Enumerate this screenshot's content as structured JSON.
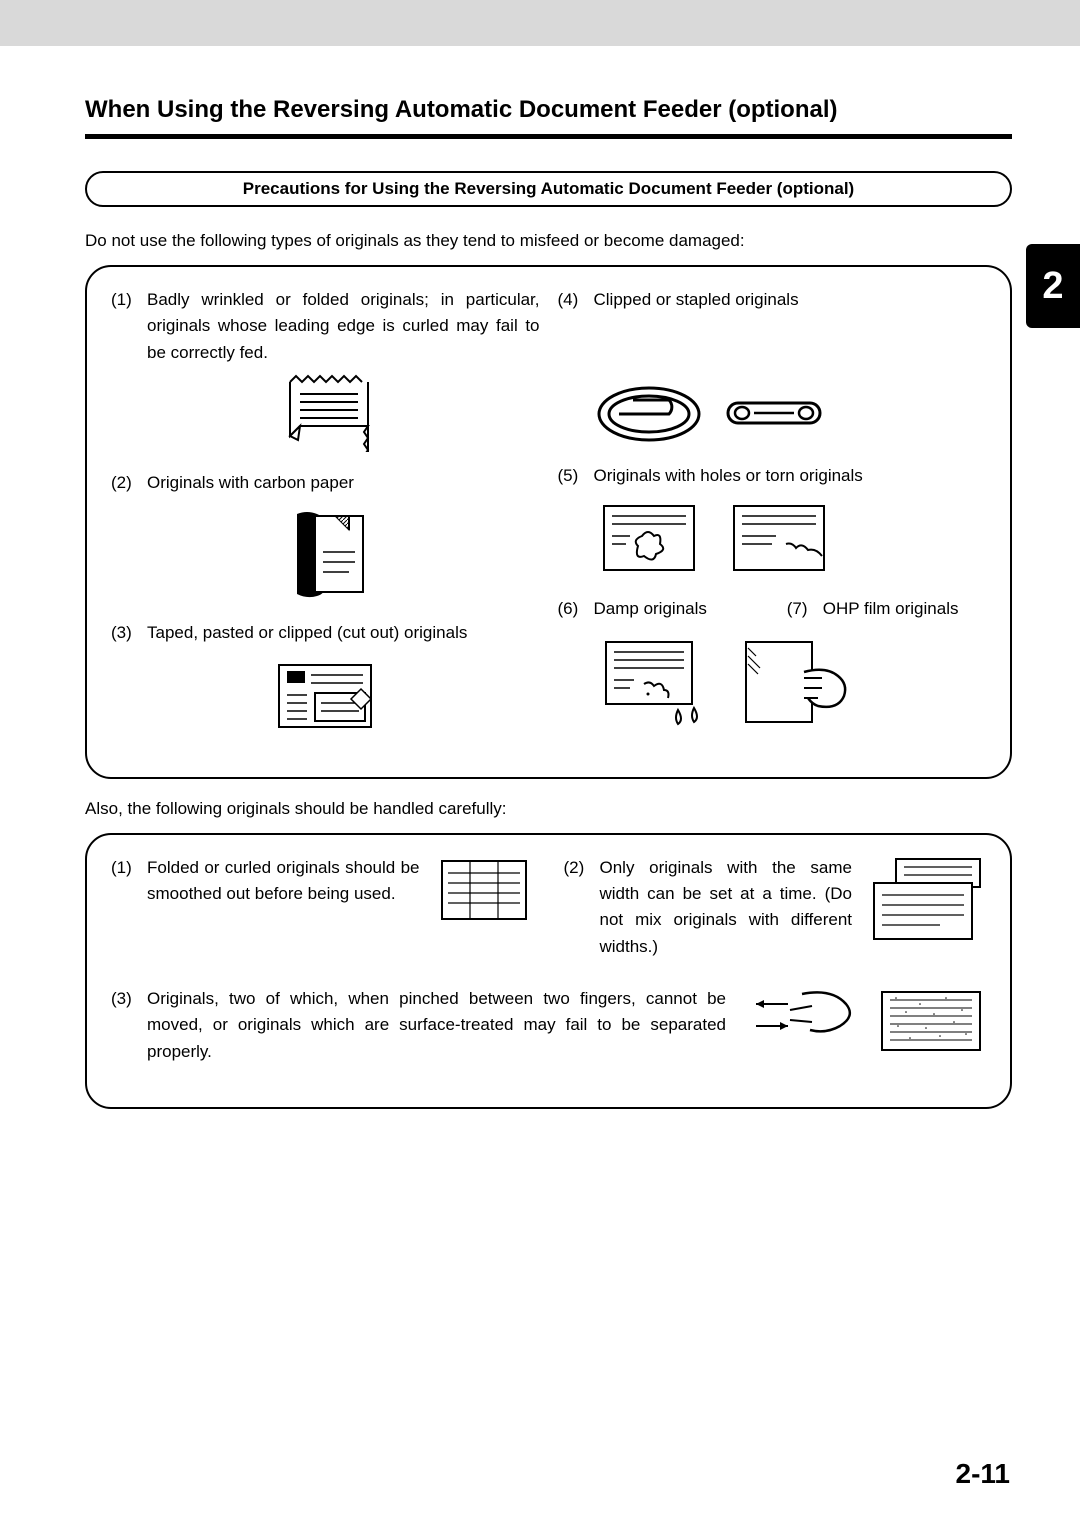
{
  "header": {
    "title": "When Using the Reversing Automatic Document Feeder (optional)"
  },
  "pill": "Precautions for Using the Reversing Automatic Document Feeder (optional)",
  "intro1": "Do not use the following types of originals as they tend to misfeed or become damaged:",
  "box1": {
    "left": [
      {
        "num": "(1)",
        "text": "Badly wrinkled or folded originals; in particular, originals whose leading edge is curled may fail to be correctly fed."
      },
      {
        "num": "(2)",
        "text": "Originals with carbon paper"
      },
      {
        "num": "(3)",
        "text": "Taped, pasted or clipped  (cut out) originals"
      }
    ],
    "right": [
      {
        "num": "(4)",
        "text": "Clipped or stapled originals"
      },
      {
        "num": "(5)",
        "text": "Originals with holes or torn originals"
      },
      {
        "num": "(6)",
        "text": "Damp originals"
      },
      {
        "num": "(7)",
        "text": "OHP film originals"
      }
    ]
  },
  "intro2": "Also, the following originals should be handled carefully:",
  "box2": {
    "items": [
      {
        "num": "(1)",
        "text": "Folded or curled originals should be smoothed out before being used."
      },
      {
        "num": "(2)",
        "text": "Only originals with the same width can be set at a time. (Do not mix originals with different widths.)"
      },
      {
        "num": "(3)",
        "text": "Originals, two of which, when pinched between two fingers, cannot be moved, or originals which are surface-treated may fail to be separated properly."
      }
    ]
  },
  "chapterTab": "2",
  "pageNumber": "2-11"
}
